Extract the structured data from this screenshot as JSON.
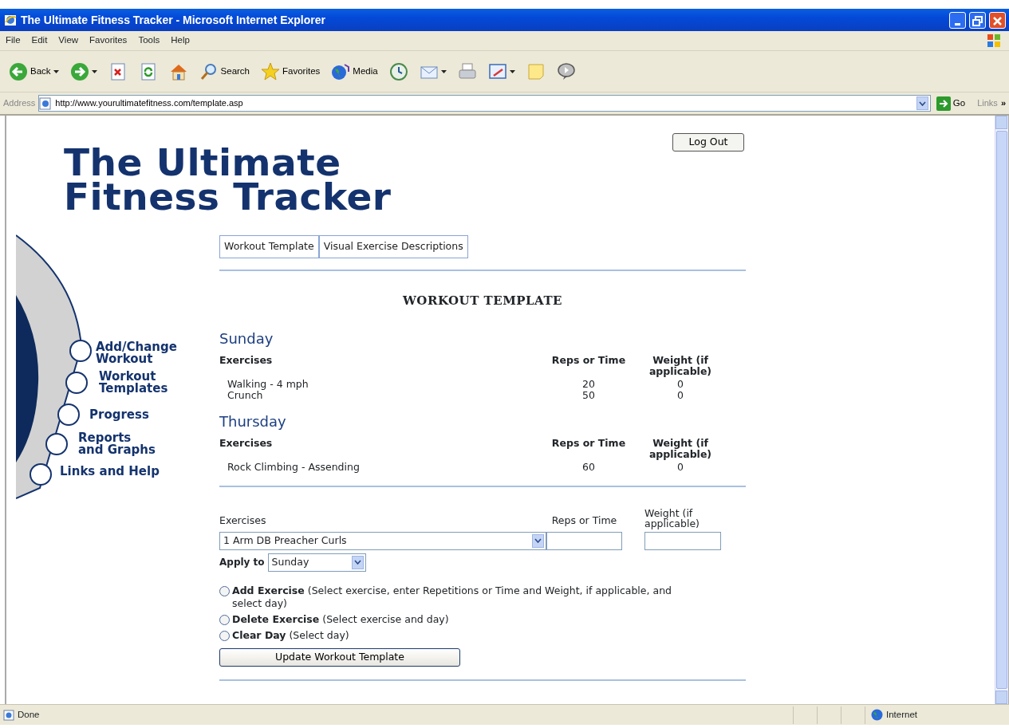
{
  "window": {
    "title": "The Ultimate Fitness Tracker - Microsoft Internet Explorer"
  },
  "menu": [
    "File",
    "Edit",
    "View",
    "Favorites",
    "Tools",
    "Help"
  ],
  "toolbar": [
    {
      "kind": "back",
      "label": "Back",
      "dropdown": true
    },
    {
      "kind": "forward",
      "dropdown": true
    },
    {
      "kind": "stop",
      "dropdown": false
    },
    {
      "kind": "refresh",
      "dropdown": false
    },
    {
      "kind": "home",
      "dropdown": false
    },
    {
      "kind": "search",
      "label": "Search",
      "dropdown": false
    },
    {
      "kind": "favorites",
      "label": "Favorites",
      "dropdown": false
    },
    {
      "kind": "media",
      "label": "Media",
      "dropdown": false
    },
    {
      "kind": "history",
      "dropdown": false
    },
    {
      "kind": "mail",
      "dropdown": true
    },
    {
      "kind": "print",
      "dropdown": false
    },
    {
      "kind": "edit",
      "dropdown": true
    },
    {
      "kind": "note",
      "dropdown": false
    },
    {
      "kind": "messenger",
      "dropdown": false
    }
  ],
  "address_bar": {
    "label": "Address",
    "url": "http://www.yourultimatefitness.com/template.asp",
    "go": "Go",
    "links": "Links",
    "more": "»"
  },
  "page": {
    "logo": [
      "The Ultimate",
      "Fitness Tracker"
    ],
    "logout": "Log Out",
    "sidebar": [
      "Add/Change\nWorkout",
      "Workout\nTemplates",
      "Progress",
      "Reports\nand Graphs",
      "Links and Help"
    ],
    "tabs": [
      "Workout Template",
      "Visual Exercise Descriptions"
    ],
    "heading": "WORKOUT TEMPLATE",
    "days": [
      {
        "name": "Sunday",
        "columns": [
          "Exercises",
          "Reps or Time",
          "Weight (if applicable)"
        ],
        "rows": [
          [
            "Walking - 4 mph",
            "20",
            "0"
          ],
          [
            "Crunch",
            "50",
            "0"
          ]
        ]
      },
      {
        "name": "Thursday",
        "columns": [
          "Exercises",
          "Reps or Time",
          "Weight (if applicable)"
        ],
        "rows": [
          [
            "Rock Climbing - Assending",
            "60",
            "0"
          ]
        ]
      }
    ],
    "form": {
      "labels": [
        "Exercises",
        "Reps or Time",
        "Weight (if applicable)"
      ],
      "exercise": "1 Arm DB Preacher Curls",
      "apply_label": "Apply to",
      "apply_day": "Sunday",
      "options": [
        {
          "text": "**Add Exercise** (Select exercise, enter Repetitions or Time and Weight, if applicable, and select day)",
          "selected": false
        },
        {
          "text": "**Delete Exercise** (Select exercise and day)",
          "selected": false
        },
        {
          "text": "**Clear Day** (Select day)",
          "selected": false
        }
      ],
      "submit": "Update Workout Template"
    }
  },
  "status_bar": {
    "text": "Done",
    "zone": "Internet"
  }
}
